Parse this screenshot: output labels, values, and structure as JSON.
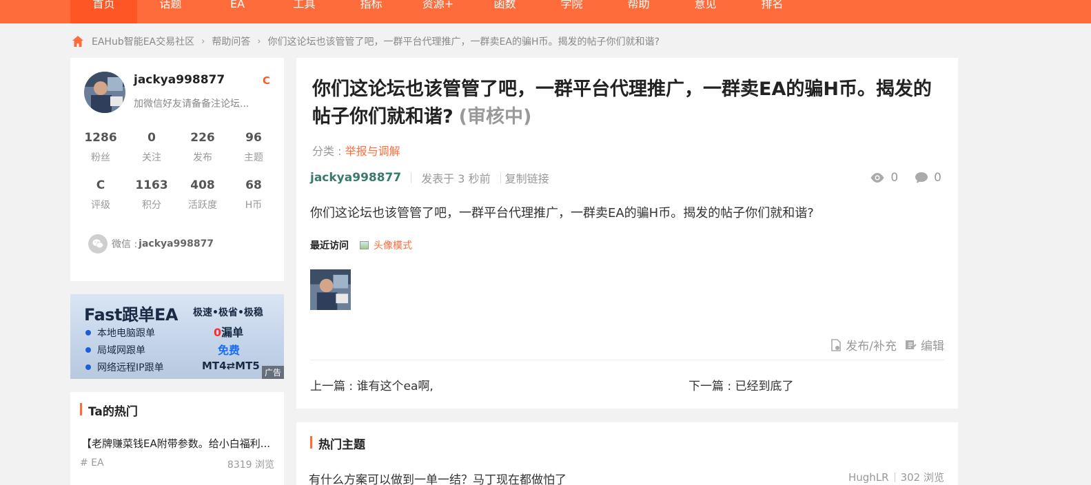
{
  "nav": {
    "items": [
      "首页",
      "话题",
      "EA",
      "工具",
      "指标",
      "资源+",
      "函数",
      "学院",
      "帮助",
      "意见",
      "排名"
    ]
  },
  "breadcrumb": {
    "home": "EAHub智能EA交易社区",
    "section": "帮助问答",
    "current": "你们这论坛也该管管了吧，一群平台代理推广，一群卖EA的骗H币。揭发的帖子你们就和谐?"
  },
  "profile": {
    "username": "jackya998877",
    "level_badge": "C",
    "signature": "加微信好友请备备注论坛...",
    "stats_row1": [
      {
        "value": "1286",
        "label": "粉丝"
      },
      {
        "value": "0",
        "label": "关注"
      },
      {
        "value": "226",
        "label": "发布"
      },
      {
        "value": "96",
        "label": "主题"
      }
    ],
    "stats_row2": [
      {
        "value": "C",
        "label": "评级"
      },
      {
        "value": "1163",
        "label": "积分"
      },
      {
        "value": "408",
        "label": "活跃度"
      },
      {
        "value": "68",
        "label": "H币"
      }
    ],
    "wechat_label": "微信 :",
    "wechat_id": "jackya998877"
  },
  "ad": {
    "title": "Fast跟单EA",
    "tagline": "极速•极省•极稳",
    "features": [
      "本地电脑跟单",
      "局域网跟单",
      "网络远程IP跟单"
    ],
    "highlight1_num": "0",
    "highlight1_text": "漏单",
    "highlight2": "免费",
    "highlight3": "MT4⇄MT5",
    "badge": "广告"
  },
  "ta_hot": {
    "title": "Ta的热门",
    "item_title": "【老牌赚菜钱EA附带参数。给小白福利...",
    "item_tag": "# EA",
    "item_views": "8319 浏览"
  },
  "post": {
    "title": "你们这论坛也该管管了吧，一群平台代理推广，一群卖EA的骗H币。揭发的帖子你们就和谐?",
    "status": "(审核中)",
    "category_label": "分类 :",
    "category": "举报与调解",
    "author": "jackya998877",
    "posted": "发表于 3 秒前",
    "copy_link": "复制链接",
    "views": "0",
    "comments": "0",
    "body": "你们这论坛也该管管了吧，一群平台代理推广，一群卖EA的骗H币。揭发的帖子你们就和谐?",
    "recent_label": "最近访问",
    "avatar_mode": "头像模式",
    "action_publish": "发布/补充",
    "action_edit": "编辑",
    "prev": "上一篇 : 谁有这个ea啊,",
    "next": "下一篇 : 已经到底了"
  },
  "hot_topics": {
    "title": "热门主题",
    "item_title": "有什么方案可以做到一单一结？马丁现在都做怕了",
    "item_author": "HughLR",
    "item_views": "302 浏览"
  },
  "colors": {
    "brand": "#ff6c3c",
    "author": "#3a7a6e"
  }
}
